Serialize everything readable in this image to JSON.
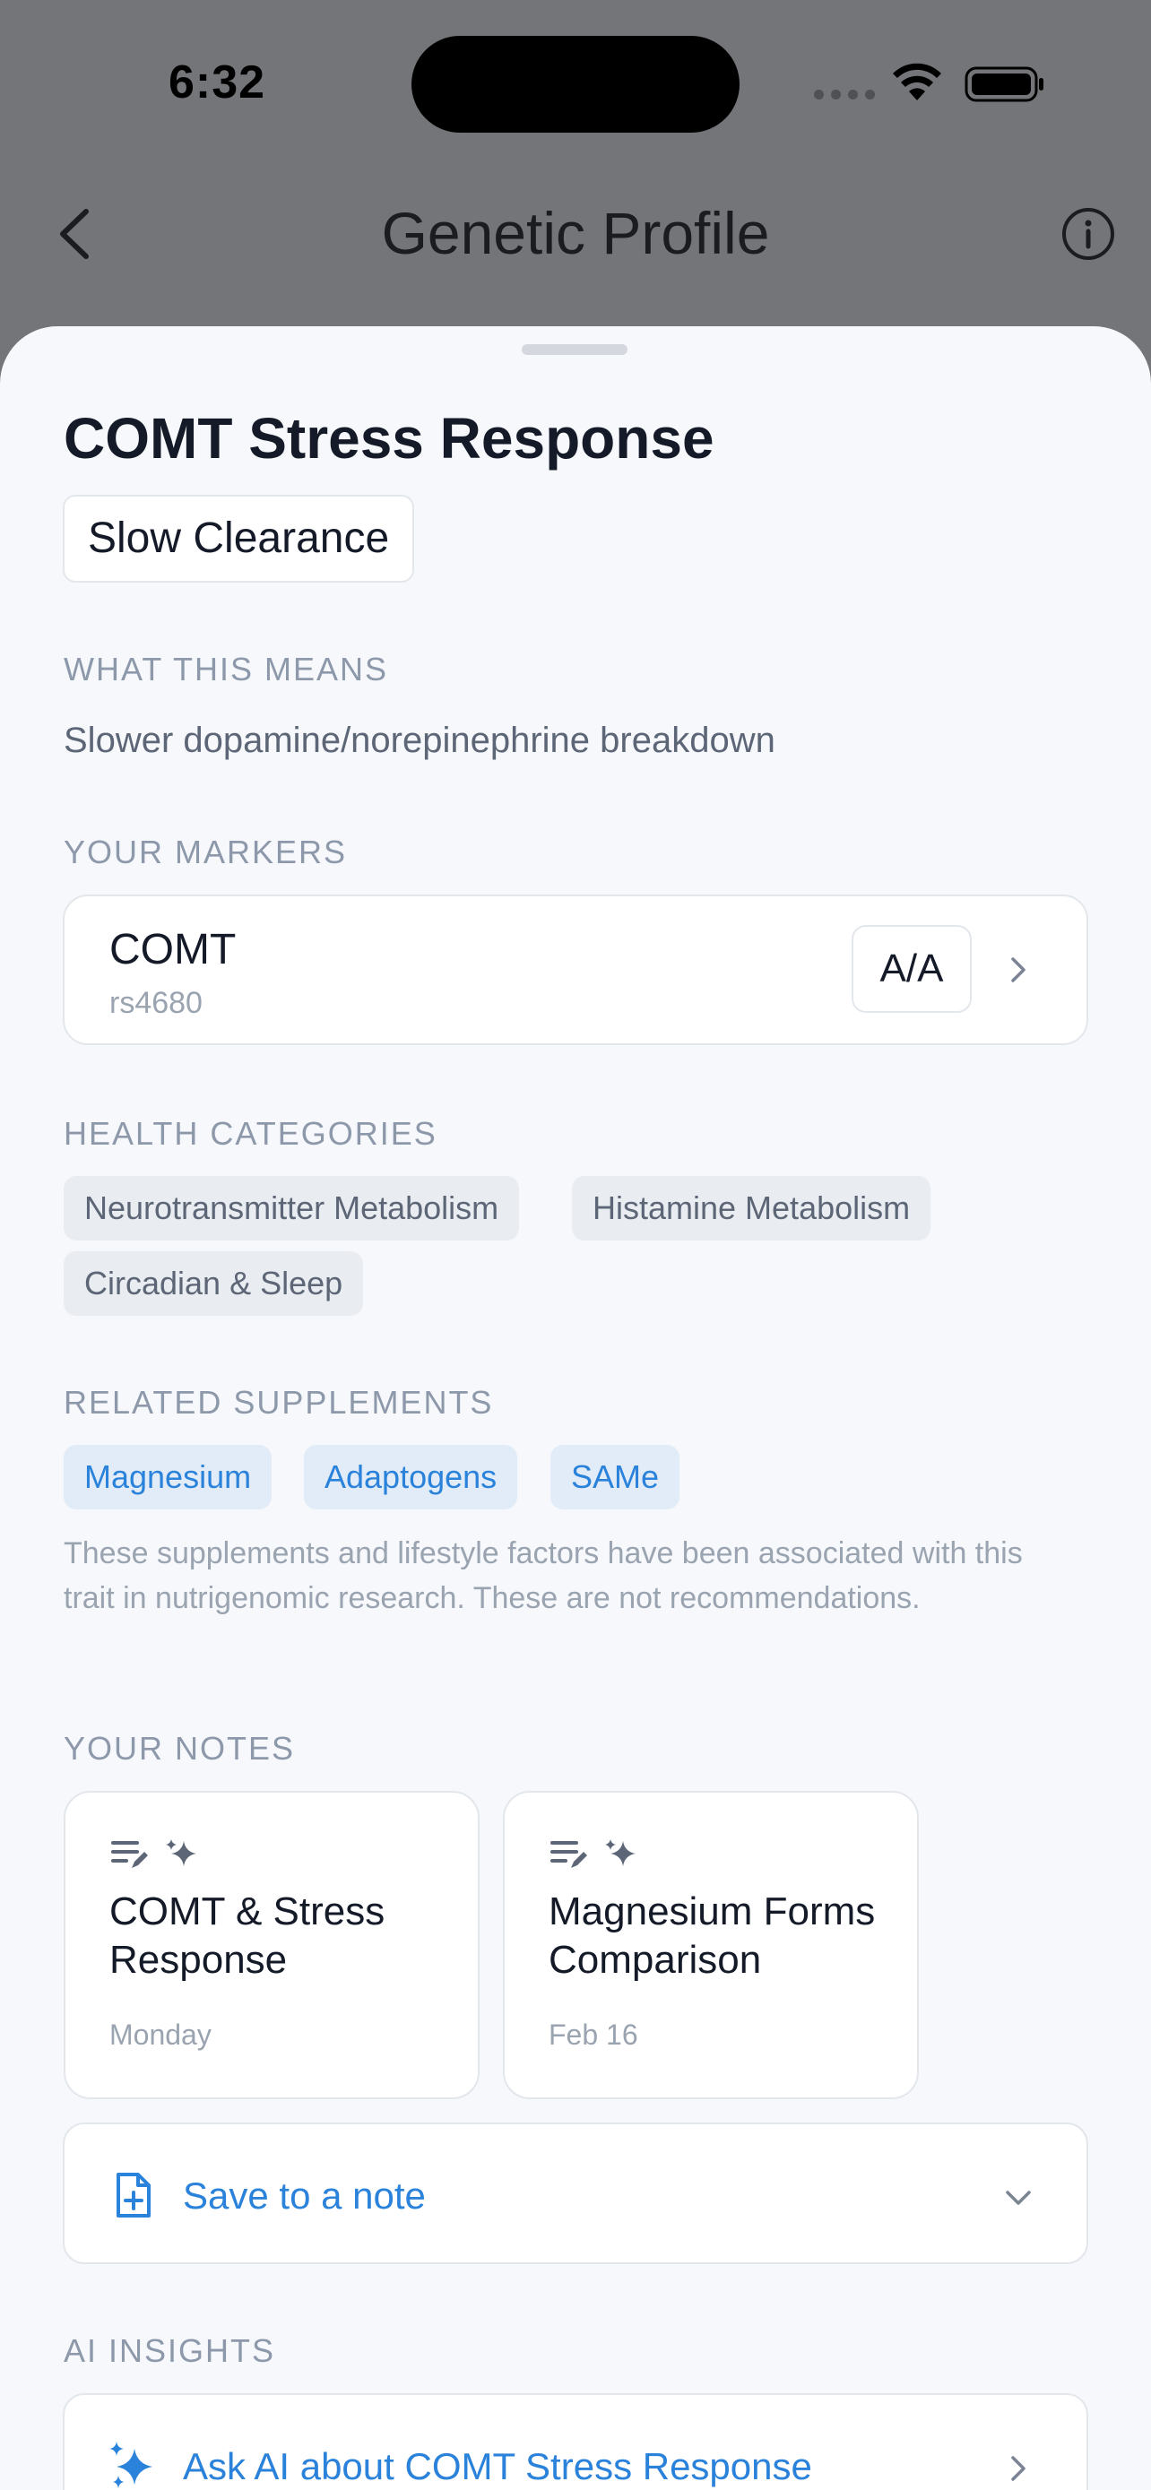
{
  "status_bar": {
    "time": "6:32"
  },
  "nav": {
    "title": "Genetic Profile"
  },
  "trait": {
    "title": "COMT Stress Response",
    "status": "Slow Clearance"
  },
  "meaning": {
    "label": "WHAT THIS MEANS",
    "text": "Slower dopamine/norepinephrine breakdown"
  },
  "markers": {
    "label": "YOUR MARKERS",
    "items": [
      {
        "gene": "COMT",
        "rsid": "rs4680",
        "genotype": "A/A"
      }
    ]
  },
  "health_categories": {
    "label": "HEALTH CATEGORIES",
    "items": [
      "Neurotransmitter Metabolism",
      "Histamine Metabolism",
      "Circadian & Sleep"
    ]
  },
  "supplements": {
    "label": "RELATED SUPPLEMENTS",
    "items": [
      "Magnesium",
      "Adaptogens",
      "SAMe"
    ],
    "disclaimer": "These supplements and lifestyle factors have been associated with this trait in nutrigenomic research. These are not recommendations."
  },
  "notes": {
    "label": "YOUR NOTES",
    "items": [
      {
        "title": "COMT & Stress Response",
        "date": "Monday"
      },
      {
        "title": "Magnesium Forms Comparison",
        "date": "Feb 16"
      }
    ],
    "save_label": "Save to a note"
  },
  "ai_insights": {
    "label": "AI INSIGHTS",
    "ask_label": "Ask AI about COMT Stress Response"
  },
  "colors": {
    "accent": "#2a82da",
    "sheet_background": "#f6f8fb",
    "dimmed_background": "#747578"
  }
}
